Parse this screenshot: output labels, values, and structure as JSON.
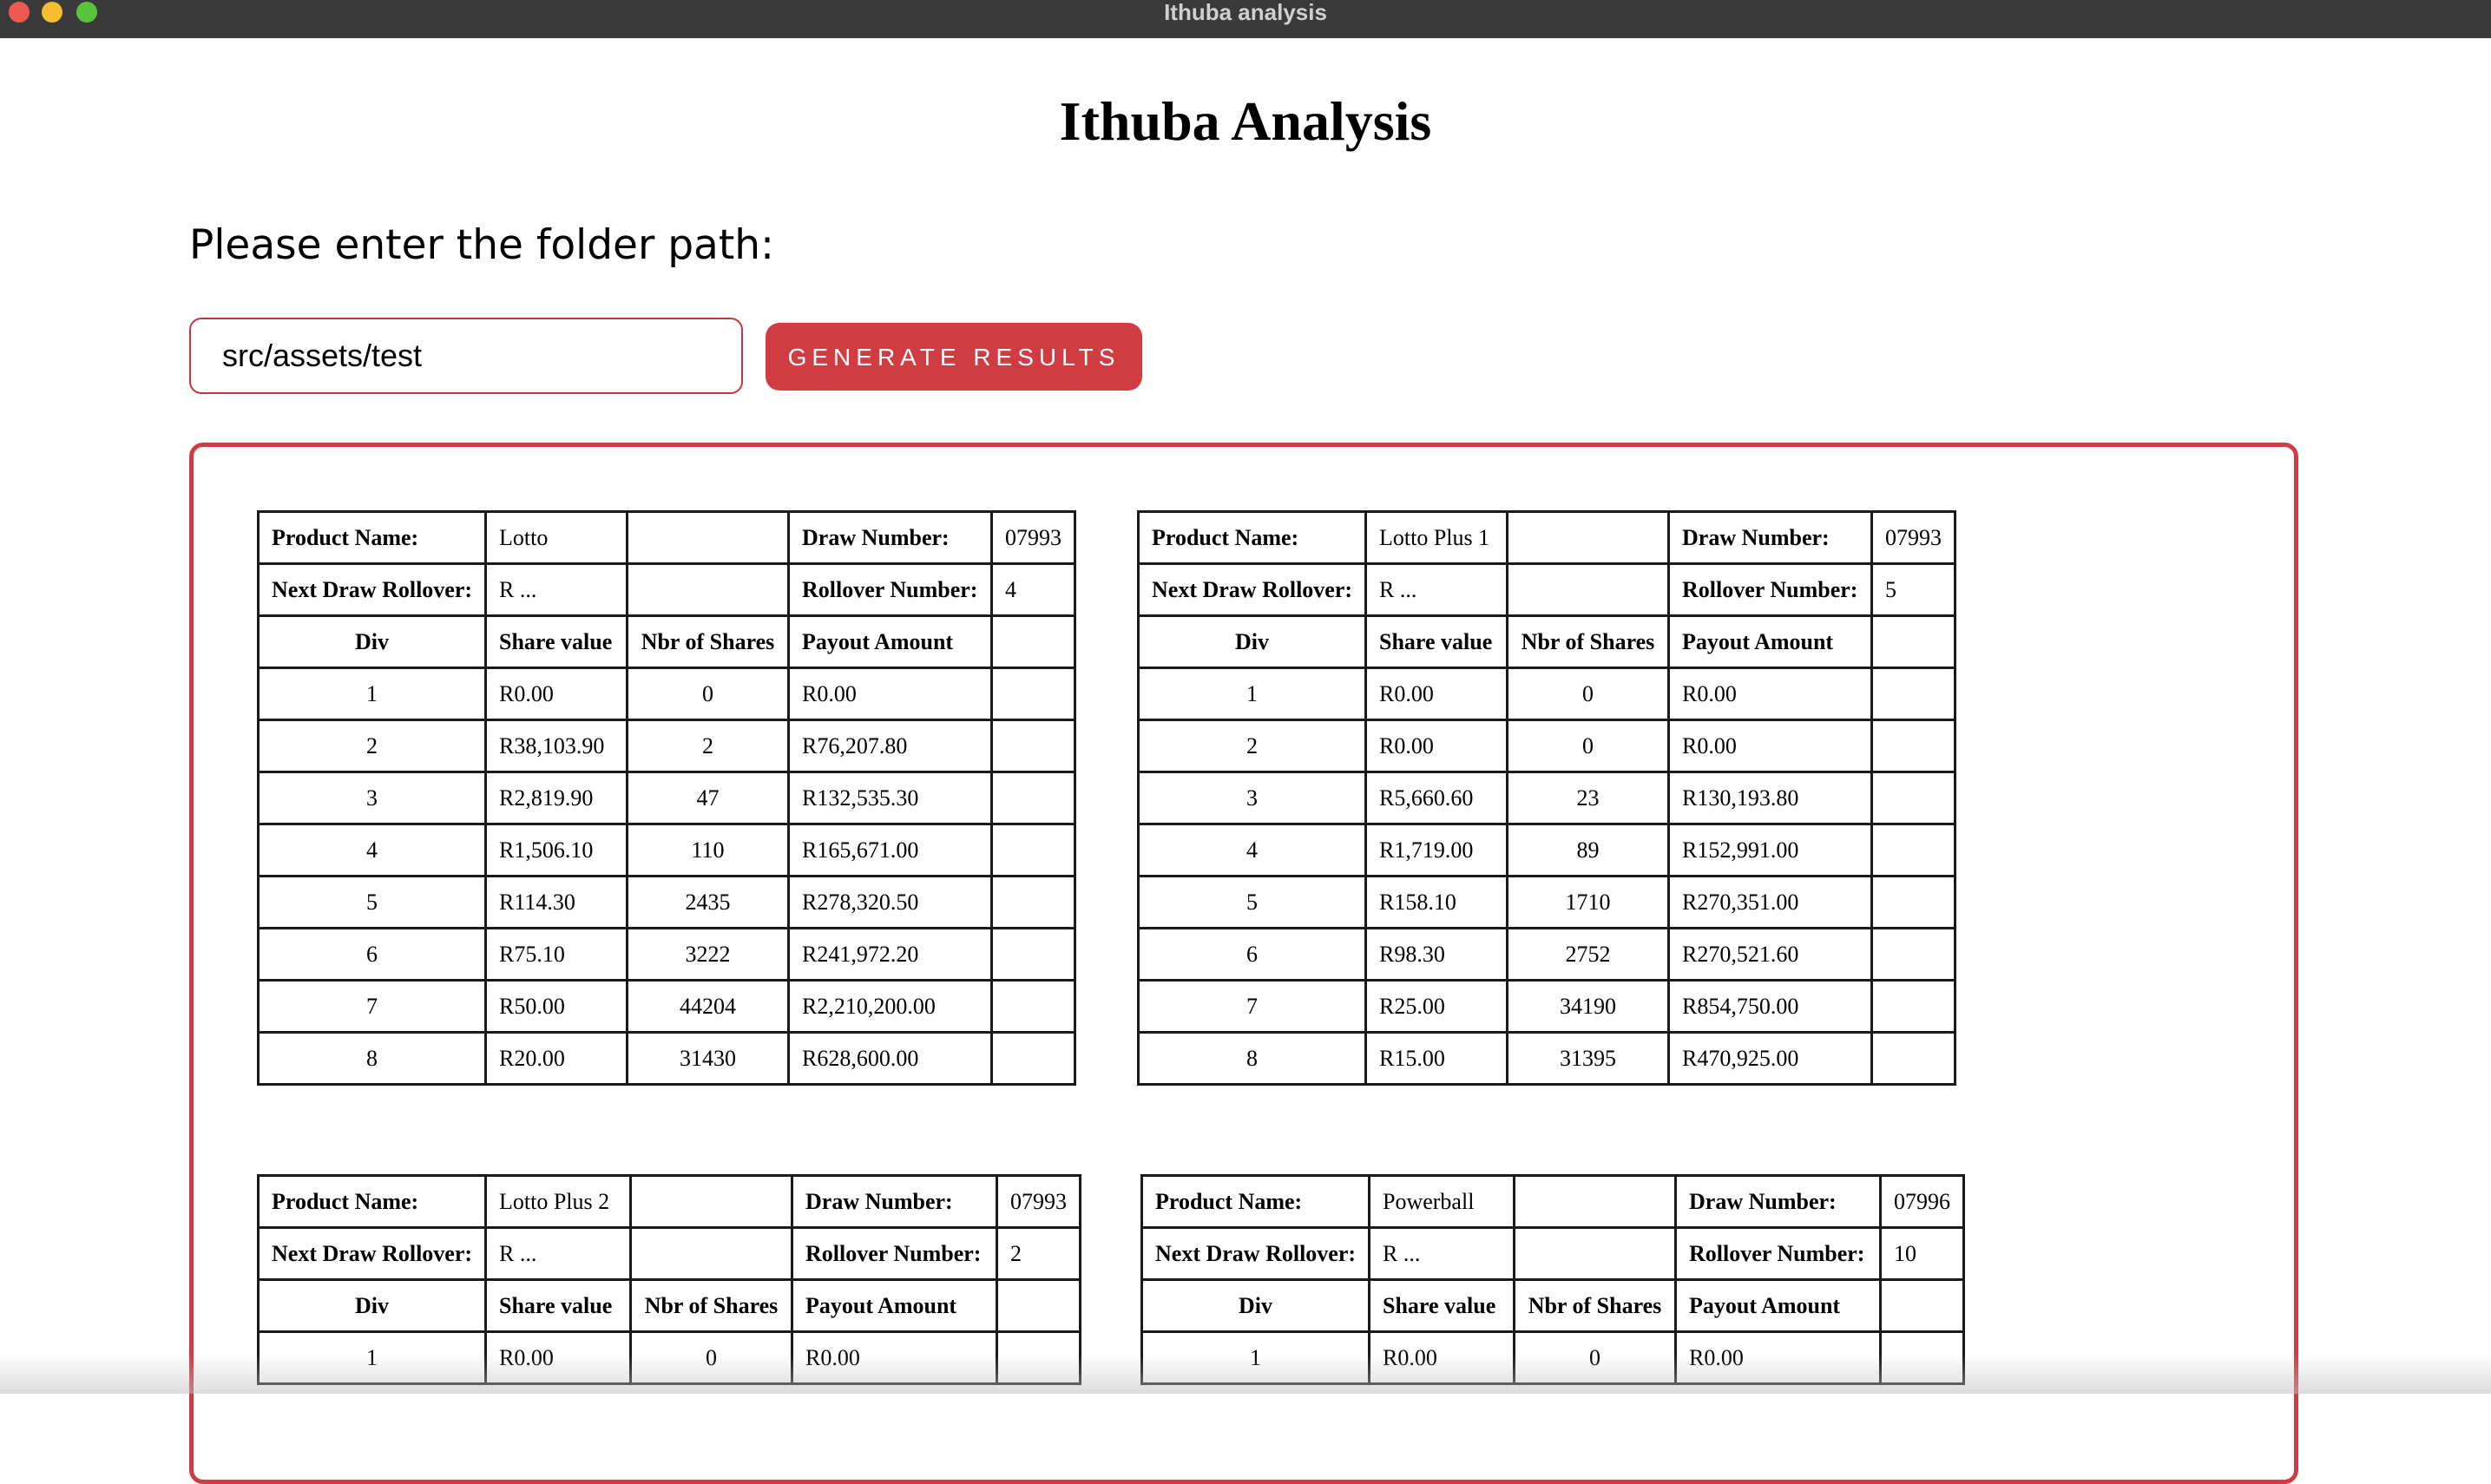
{
  "window": {
    "title": "Ithuba analysis"
  },
  "page": {
    "title": "Ithuba Analysis",
    "prompt": "Please enter the folder path:",
    "folder_input_value": "src/assets/test",
    "generate_button": "GENERATE RESULTS"
  },
  "labels": {
    "product_name": "Product Name:",
    "draw_number": "Draw Number:",
    "next_draw_rollover": "Next Draw Rollover:",
    "rollover_number": "Rollover Number:",
    "div": "Div",
    "share_value": "Share value",
    "nbr_of_shares": "Nbr of Shares",
    "payout_amount": "Payout Amount"
  },
  "colors": {
    "accent": "#d13c43",
    "titlebar": "#3a3a3a"
  },
  "tables": [
    {
      "product": "Lotto",
      "draw_number": "07993",
      "next_draw_rollover": "R ...",
      "rollover_number": "4",
      "rows": [
        {
          "div": "1",
          "share_value": "R0.00",
          "nbr_shares": "0",
          "payout": "R0.00"
        },
        {
          "div": "2",
          "share_value": "R38,103.90",
          "nbr_shares": "2",
          "payout": "R76,207.80"
        },
        {
          "div": "3",
          "share_value": "R2,819.90",
          "nbr_shares": "47",
          "payout": "R132,535.30"
        },
        {
          "div": "4",
          "share_value": "R1,506.10",
          "nbr_shares": "110",
          "payout": "R165,671.00"
        },
        {
          "div": "5",
          "share_value": "R114.30",
          "nbr_shares": "2435",
          "payout": "R278,320.50"
        },
        {
          "div": "6",
          "share_value": "R75.10",
          "nbr_shares": "3222",
          "payout": "R241,972.20"
        },
        {
          "div": "7",
          "share_value": "R50.00",
          "nbr_shares": "44204",
          "payout": "R2,210,200.00"
        },
        {
          "div": "8",
          "share_value": "R20.00",
          "nbr_shares": "31430",
          "payout": "R628,600.00"
        }
      ]
    },
    {
      "product": "Lotto Plus 1",
      "draw_number": "07993",
      "next_draw_rollover": "R ...",
      "rollover_number": "5",
      "rows": [
        {
          "div": "1",
          "share_value": "R0.00",
          "nbr_shares": "0",
          "payout": "R0.00"
        },
        {
          "div": "2",
          "share_value": "R0.00",
          "nbr_shares": "0",
          "payout": "R0.00"
        },
        {
          "div": "3",
          "share_value": "R5,660.60",
          "nbr_shares": "23",
          "payout": "R130,193.80"
        },
        {
          "div": "4",
          "share_value": "R1,719.00",
          "nbr_shares": "89",
          "payout": "R152,991.00"
        },
        {
          "div": "5",
          "share_value": "R158.10",
          "nbr_shares": "1710",
          "payout": "R270,351.00"
        },
        {
          "div": "6",
          "share_value": "R98.30",
          "nbr_shares": "2752",
          "payout": "R270,521.60"
        },
        {
          "div": "7",
          "share_value": "R25.00",
          "nbr_shares": "34190",
          "payout": "R854,750.00"
        },
        {
          "div": "8",
          "share_value": "R15.00",
          "nbr_shares": "31395",
          "payout": "R470,925.00"
        }
      ]
    },
    {
      "product": "Lotto Plus 2",
      "draw_number": "07993",
      "next_draw_rollover": "R ...",
      "rollover_number": "2",
      "rows": [
        {
          "div": "1",
          "share_value": "R0.00",
          "nbr_shares": "0",
          "payout": "R0.00"
        }
      ]
    },
    {
      "product": "Powerball",
      "draw_number": "07996",
      "next_draw_rollover": "R ...",
      "rollover_number": "10",
      "rows": [
        {
          "div": "1",
          "share_value": "R0.00",
          "nbr_shares": "0",
          "payout": "R0.00"
        }
      ]
    }
  ]
}
